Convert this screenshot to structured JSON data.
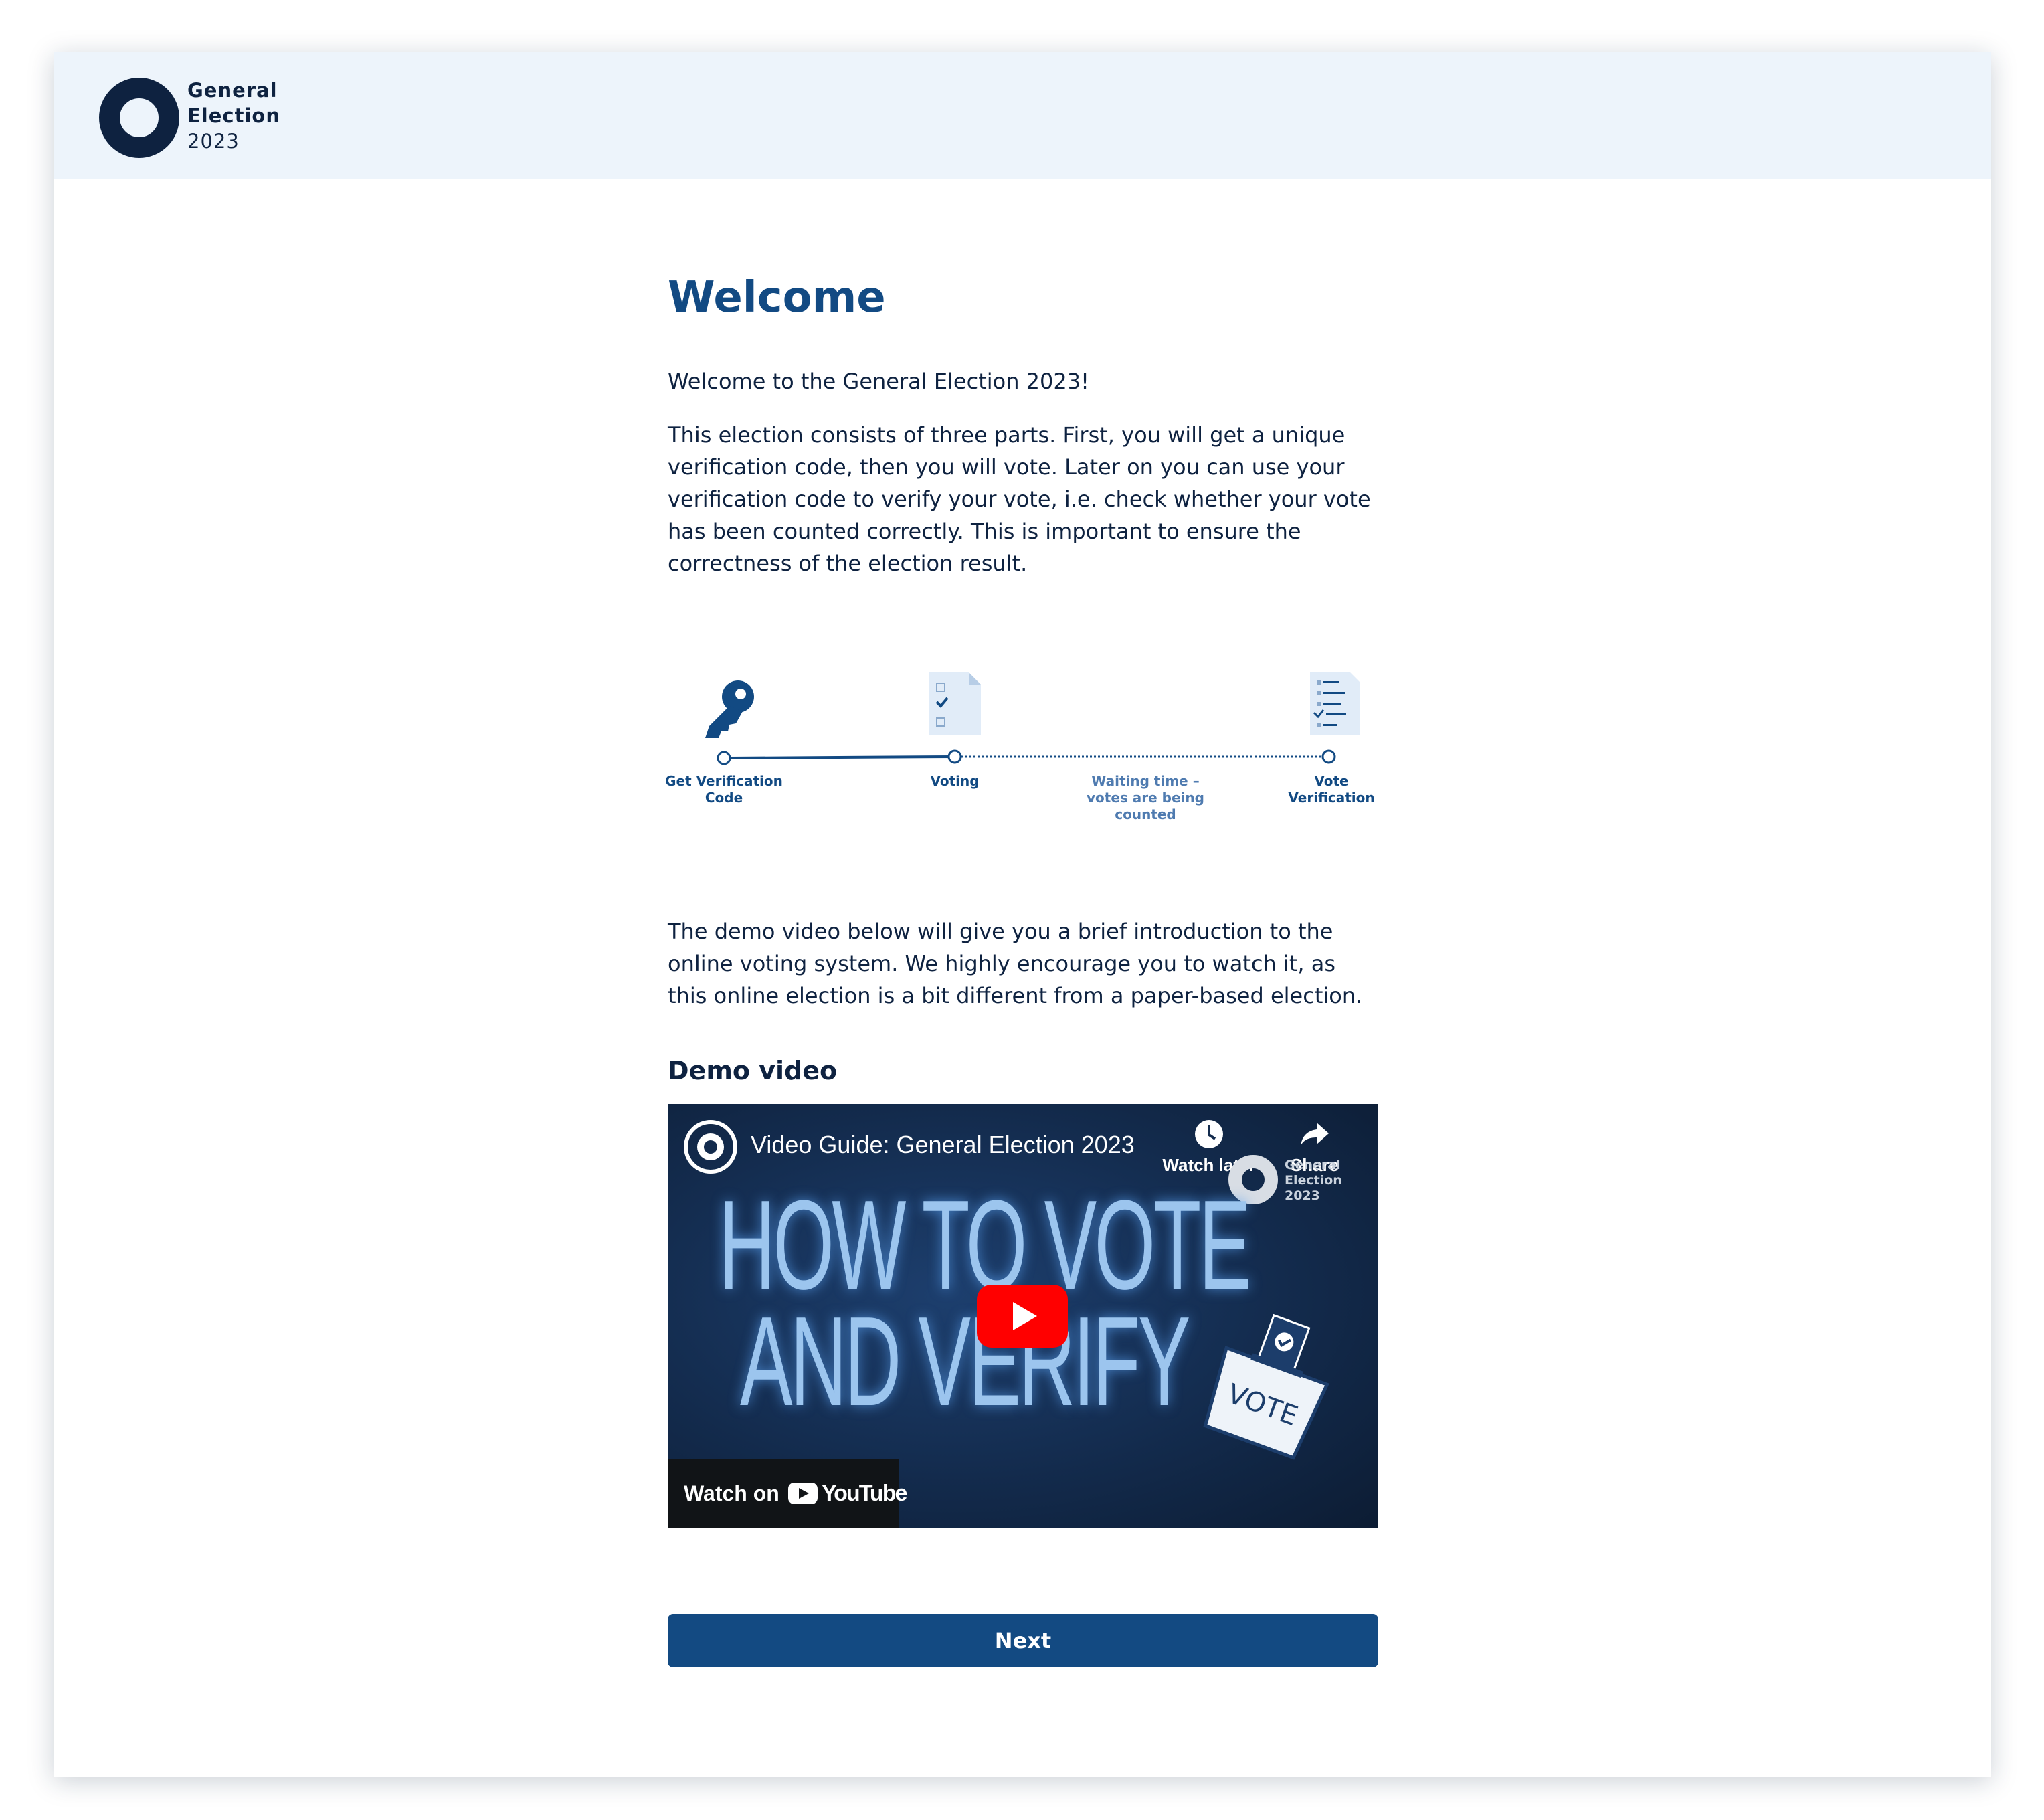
{
  "header": {
    "logo_line1": "General",
    "logo_line2": "Election",
    "logo_line3": "2023"
  },
  "main": {
    "title": "Welcome",
    "intro": "Welcome to the General Election 2023!",
    "description": "This election consists of three parts. First, you will get a unique verification code, then you will vote. Later on you can use your verification code to verify your vote, i.e. check whether your vote has been counted correctly. This is important to ensure the correctness of the election result.",
    "demo_intro": "The demo video below will give you a brief introduction to the online voting system. We highly encourage you to watch it, as this online election is a bit different from a paper-based election.",
    "demo_title": "Demo video"
  },
  "timeline": {
    "step1_line1": "Get Verification",
    "step1_line2": "Code",
    "step2": "Voting",
    "wait_line1": "Waiting time –",
    "wait_line2": "votes are being counted",
    "step3_line1": "Vote",
    "step3_line2": "Verification"
  },
  "video": {
    "title": "Video Guide: General Election 2023",
    "watch_later": "Watch later",
    "share": "Share",
    "brand_line1": "General",
    "brand_line2": "Election",
    "brand_line3": "2023",
    "headline_line1": "HOW TO VOTE",
    "headline_line2": "AND VERIFY",
    "ballot_text": "VOTE",
    "watch_on": "Watch on",
    "youtube": "YouTube"
  },
  "footer": {
    "next_label": "Next"
  },
  "colors": {
    "primary": "#134a82",
    "dark": "#0e2240",
    "header_bg": "#edf4fb",
    "play_red": "#ff0000"
  }
}
